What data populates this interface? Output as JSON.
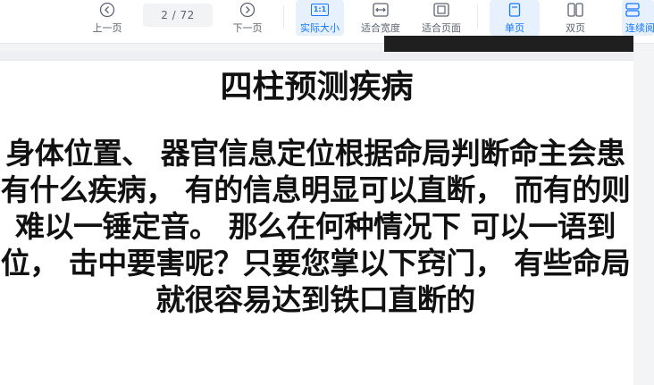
{
  "toolbar": {
    "prev_label": "上一页",
    "page_indicator": "2 / 72",
    "next_label": "下一页",
    "actual_size_label": "实际大小",
    "actual_size_icon_text": "1:1",
    "fit_width_label": "适合宽度",
    "fit_page_label": "适合页面",
    "single_page_label": "单页",
    "double_page_label": "双页",
    "continuous_label": "连续阅"
  },
  "document": {
    "title": "四柱预测疾病",
    "body": "身体位置、 器官信息定位根据命局判断命主会患有什么疾病， 有的信息明显可以直断， 而有的则难以一锤定音。 那么在何种情况下 可以一语到位， 击中要害呢？只要您掌以下窍门， 有些命局就很容易达到铁口直断的"
  },
  "colors": {
    "accent": "#1677ff",
    "active_bg": "#e6f1fd",
    "toolbar_text": "#5c6370"
  }
}
